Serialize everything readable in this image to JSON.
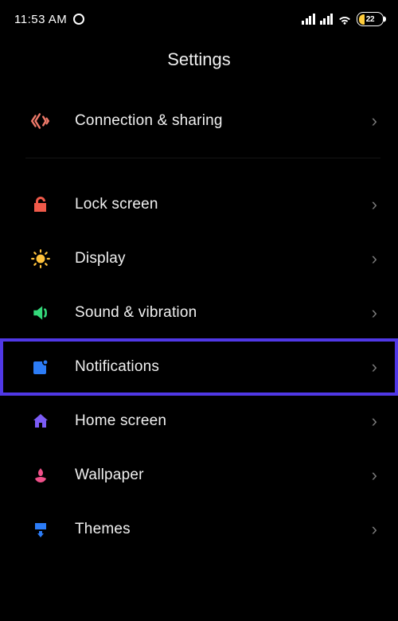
{
  "status": {
    "time": "11:53 AM",
    "battery_pct": "22"
  },
  "title": "Settings",
  "colors": {
    "connection": "#f07a6a",
    "lock": "#f05a4a",
    "display": "#ffc23c",
    "sound": "#34d97a",
    "notifications": "#2c7cf6",
    "home": "#7c5cf6",
    "wallpaper": "#f0508a",
    "themes": "#2c7cf6",
    "highlight_border": "#5038e6"
  },
  "items": [
    {
      "id": "connection",
      "label": "Connection & sharing"
    },
    {
      "id": "lock",
      "label": "Lock screen"
    },
    {
      "id": "display",
      "label": "Display"
    },
    {
      "id": "sound",
      "label": "Sound & vibration"
    },
    {
      "id": "notifications",
      "label": "Notifications",
      "highlighted": true
    },
    {
      "id": "home",
      "label": "Home screen"
    },
    {
      "id": "wallpaper",
      "label": "Wallpaper"
    },
    {
      "id": "themes",
      "label": "Themes"
    }
  ]
}
